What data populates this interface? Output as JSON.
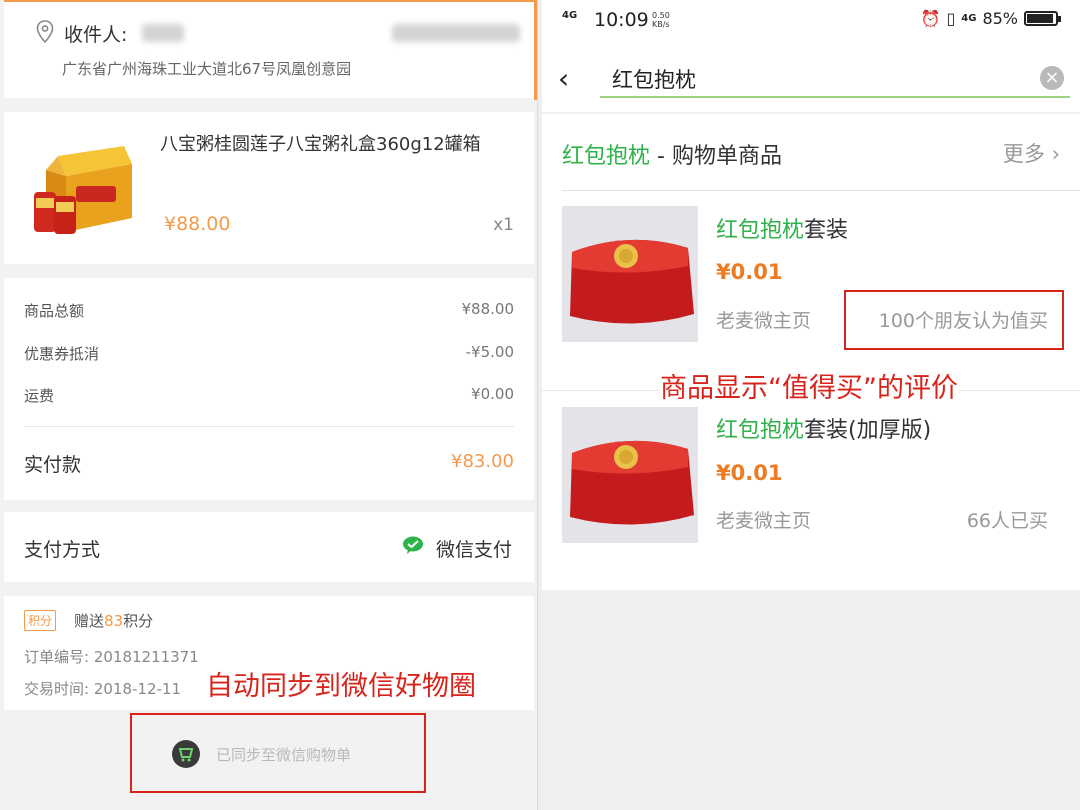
{
  "left": {
    "receiver": {
      "label": "收件人:",
      "address": "广东省广州海珠工业大道北67号凤凰创意园"
    },
    "product": {
      "name": "八宝粥桂圆莲子八宝粥礼盒360g12罐箱",
      "price": "¥88.00",
      "qty": "x1"
    },
    "fees": [
      {
        "label": "商品总额",
        "value": "¥88.00"
      },
      {
        "label": "优惠券抵消",
        "value": "-¥5.00"
      },
      {
        "label": "运费",
        "value": "¥0.00"
      }
    ],
    "total": {
      "label": "实付款",
      "value": "¥83.00"
    },
    "payment": {
      "label": "支付方式",
      "method": "微信支付"
    },
    "order": {
      "points_badge": "积分",
      "points_prefix": "赠送",
      "points_value": "83",
      "points_suffix": "积分",
      "order_no": "订单编号: 20181211371",
      "order_time": "交易时间: 2018-12-11"
    },
    "annotation": "自动同步到微信好物圈",
    "sync_text": "已同步至微信购物单"
  },
  "right": {
    "status": {
      "net": "4G",
      "time": "10:09",
      "speed_top": "0.50",
      "speed_bottom": "KB/s",
      "net2": "4G",
      "battery": "85%"
    },
    "search": {
      "back": "‹",
      "query": "红包抱枕",
      "clear": "×"
    },
    "section": {
      "highlight": "红包抱枕",
      "rest": " - 购物单商品",
      "more": "更多 ›"
    },
    "items": [
      {
        "title_hl": "红包抱枕",
        "title_rest": "套装",
        "price": "¥0.01",
        "shop": "老麦微主页",
        "right": "100个朋友认为值买"
      },
      {
        "title_hl": "红包抱枕",
        "title_rest": "套装(加厚版)",
        "price": "¥0.01",
        "shop": "老麦微主页",
        "right": "66人已买"
      }
    ],
    "annotation": "商品显示“值得买”的评价"
  },
  "colors": {
    "accent_orange": "#f39a4c",
    "wechat_green": "#2eb34a",
    "annotation_red": "#d9241c"
  }
}
